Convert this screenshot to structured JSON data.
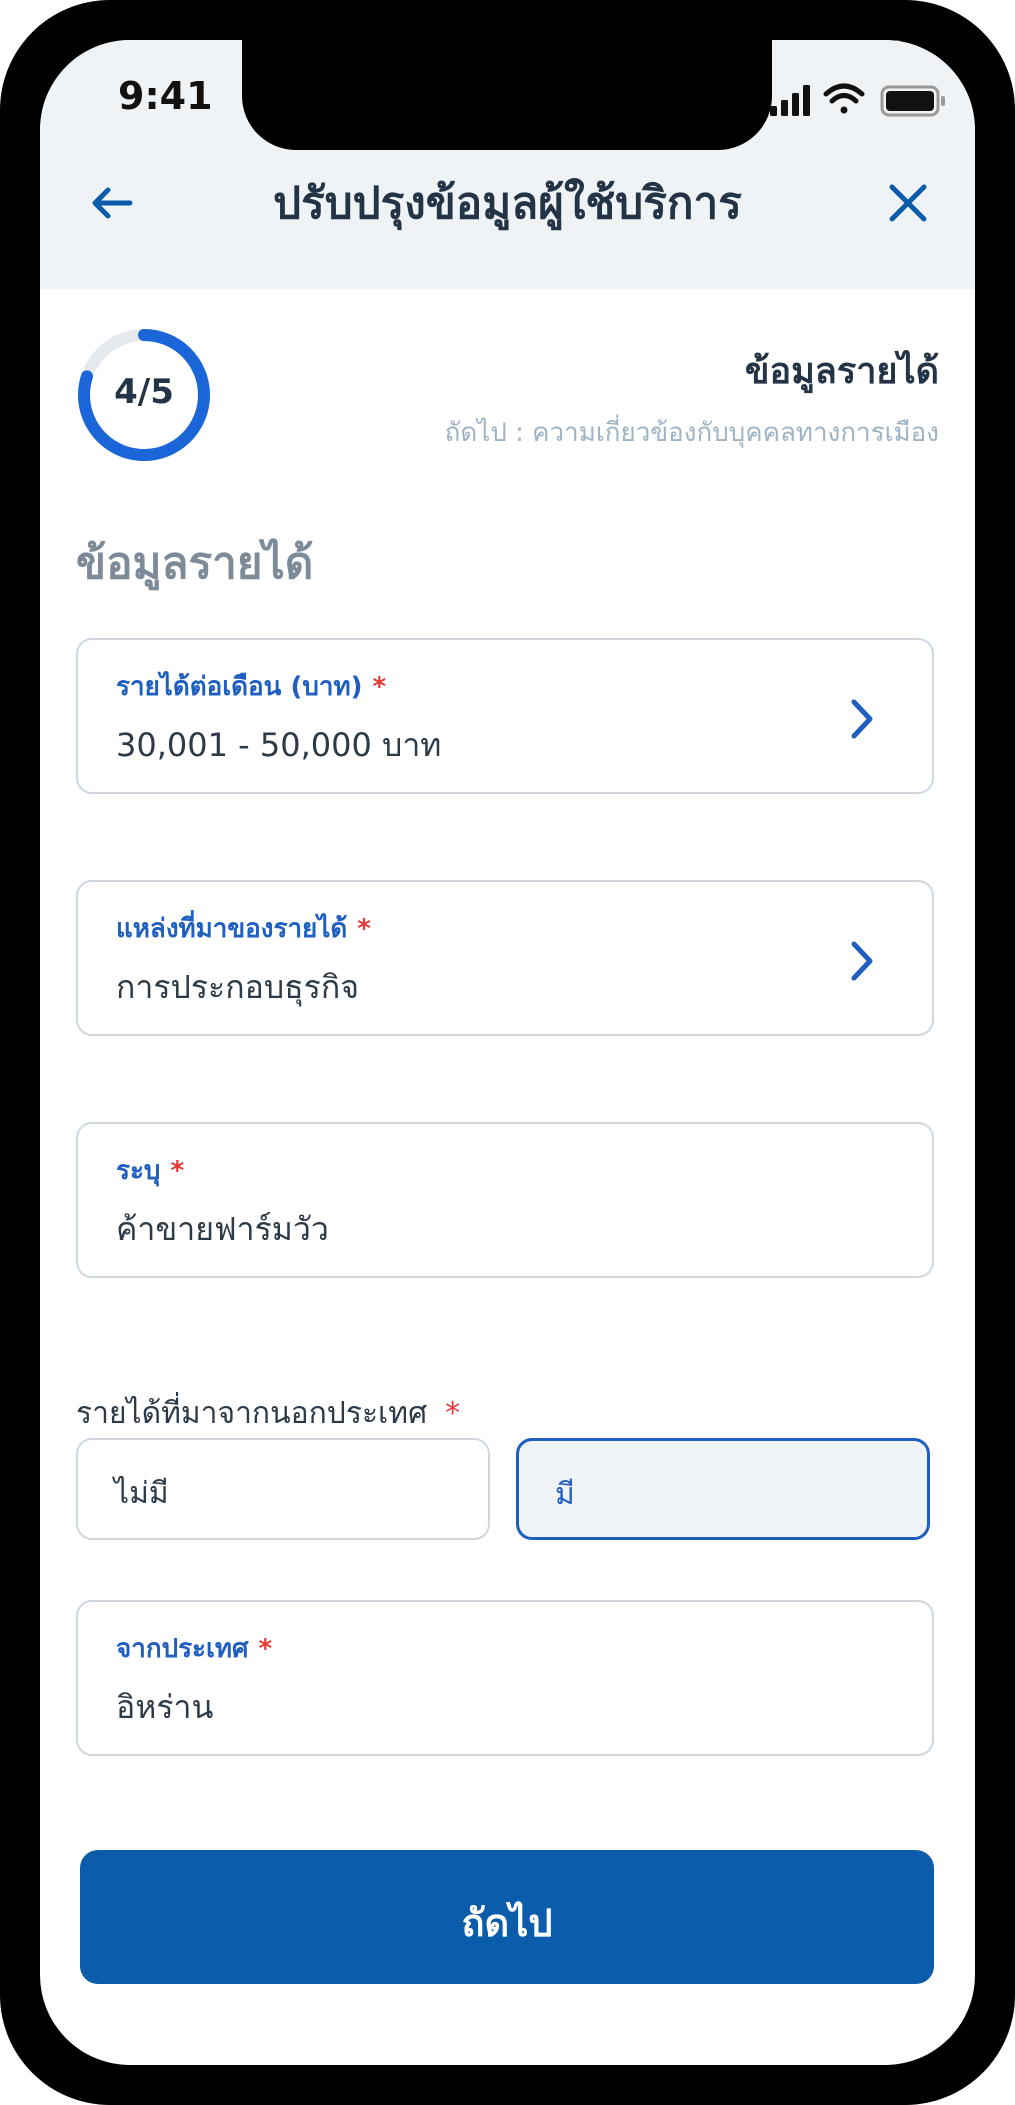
{
  "status_bar": {
    "time": "9:41"
  },
  "header": {
    "title": "ปรับปรุงข้อมูลผู้ใช้บริการ"
  },
  "progress": {
    "label": "4/5",
    "current": 4,
    "total": 5
  },
  "step": {
    "title": "ข้อมูลรายได้",
    "next_hint": "ถัดไป : ความเกี่ยวข้องกับบุคคลทางการเมือง"
  },
  "section": {
    "title": "ข้อมูลรายได้"
  },
  "fields": [
    {
      "label": "รายได้ต่อเดือน (บาท)",
      "required": "*",
      "value": "30,001 - 50,000 บาท"
    },
    {
      "label": "แหล่งที่มาของรายได้",
      "required": "*",
      "value": "การประกอบธุรกิจ"
    },
    {
      "label": "ระบุ",
      "required": "*",
      "value": "ค้าขายฟาร์มวัว"
    },
    {
      "label": "จากประเทศ",
      "required": "*",
      "value": "อิหร่าน"
    }
  ],
  "foreign_income": {
    "question": "รายได้ที่มาจากนอกประเทศ",
    "required": "*",
    "options": [
      "ไม่มี",
      "มี"
    ],
    "selected": "มี"
  },
  "actions": {
    "next_label": "ถัดไป"
  },
  "colors": {
    "primary": "#0b5cab",
    "accent_blue": "#1e5fc0",
    "required_red": "#e53935",
    "header_bg": "#f0f3f6",
    "progress_track": "#e6eaee",
    "progress_fill": "#1a66d9"
  }
}
